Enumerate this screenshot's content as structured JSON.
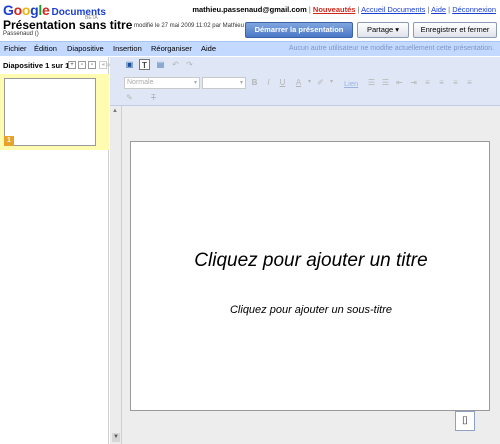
{
  "header": {
    "logo_text": "Google",
    "logo_product": "Documents",
    "logo_beta": "BETA",
    "email": "mathieu.passenaud@gmail.com",
    "new_label": "Nouveautés",
    "links": [
      "Accueil Documents",
      "Aide",
      "Déconnexion"
    ],
    "doc_title": "Présentation sans titre",
    "modified": "modifié le 27 mai 2009 11:02 par Mathieu",
    "modified_cont": "Passenaud ()",
    "start_button": "Démarrer la présentation",
    "share_button": "Partage ▾",
    "save_button": "Enregistrer et fermer"
  },
  "menu": {
    "items": [
      "Fichier",
      "Édition",
      "Diapositive",
      "Insertion",
      "Réorganiser",
      "Aide"
    ],
    "notice": "Aucun autre utilisateur ne modifie actuellement cette présentation."
  },
  "leftpanel": {
    "slide_count": "Diapositive 1 sur 1",
    "thumb_number": "1"
  },
  "toolbar": {
    "style_select": "Normale",
    "size_select": "",
    "link_label": "Lien",
    "bold": "B",
    "italic": "I",
    "underline": "U",
    "text_color": "A",
    "highlight": "✐"
  },
  "slide": {
    "title": "Cliquez pour ajouter un titre",
    "subtitle": "Cliquez pour ajouter un sous-titre"
  },
  "colors": {
    "menubar": "#c3d9ff",
    "accent": "#4a78c6",
    "highlight": "#fffbb0"
  }
}
